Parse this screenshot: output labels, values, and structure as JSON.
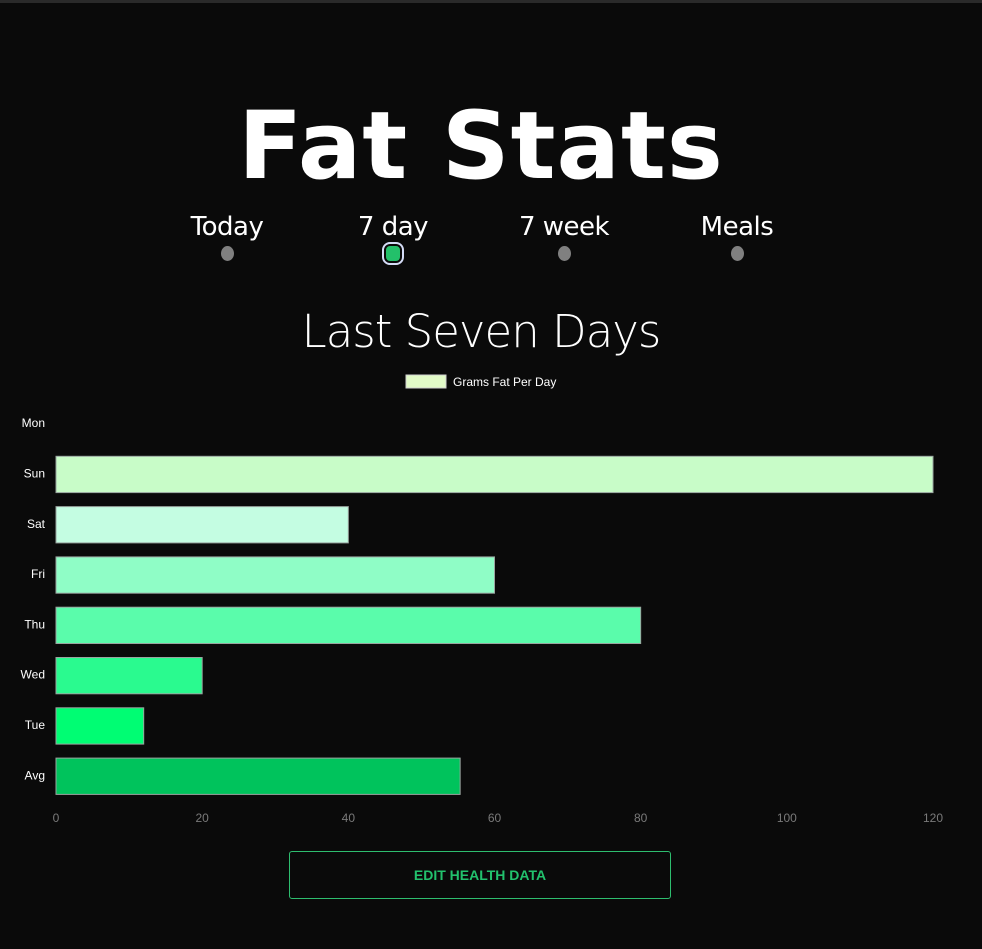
{
  "app": {
    "title": "Fat Stats"
  },
  "nav": {
    "items": [
      {
        "label": "Today",
        "selected": false
      },
      {
        "label": "7 day",
        "selected": true
      },
      {
        "label": "7 week",
        "selected": false
      },
      {
        "label": "Meals",
        "selected": false
      }
    ]
  },
  "chart_data": {
    "type": "bar",
    "orientation": "horizontal",
    "title": "Last Seven Days",
    "legend": {
      "label": "Grams Fat Per Day",
      "color": "#e2fbc8",
      "placement": "top-center"
    },
    "categories": [
      "Mon",
      "Sun",
      "Sat",
      "Fri",
      "Thu",
      "Wed",
      "Tue",
      "Avg"
    ],
    "values": [
      0,
      120,
      40,
      60,
      80,
      20,
      12,
      55.3
    ],
    "colors": [
      "#c8fcc8",
      "#c8fcc8",
      "#c4fde2",
      "#8ffdc6",
      "#5afcab",
      "#2afa8f",
      "#00fd73",
      "#00c35c"
    ],
    "xticks": [
      0,
      20,
      40,
      60,
      80,
      100,
      120
    ],
    "xlim": [
      0,
      120
    ],
    "grid": false
  },
  "actions": {
    "edit_label": "EDIT HEALTH DATA"
  }
}
